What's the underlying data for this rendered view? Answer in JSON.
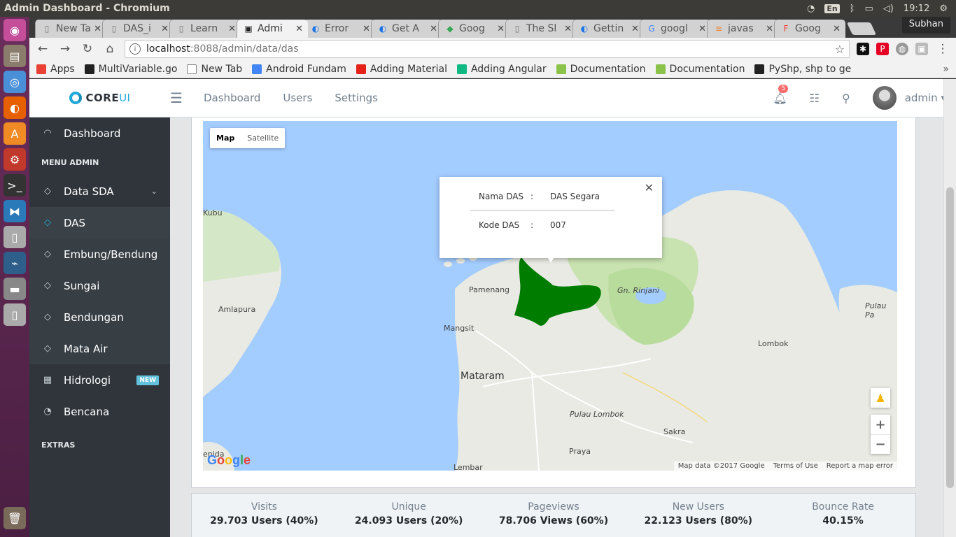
{
  "os": {
    "window_title": "Admin Dashboard - Chromium",
    "keyboard": "En",
    "clock": "19:12",
    "launcher_icons": [
      "ubuntu-dash-icon",
      "files-icon",
      "chromium-icon",
      "firefox-icon",
      "software-center-icon",
      "settings-icon",
      "terminal-icon",
      "vscode-icon",
      "usb-icon",
      "network-tool-icon",
      "drive-icon",
      "usb-icon-2",
      "trash-icon"
    ]
  },
  "browser": {
    "profile": "Subhan",
    "tabs": [
      {
        "label": "New Tab",
        "icon": "page-icon"
      },
      {
        "label": "DAS_i",
        "icon": "page-icon"
      },
      {
        "label": "Learn",
        "icon": "page-icon"
      },
      {
        "label": "Admi",
        "icon": "terminal-favicon",
        "active": true
      },
      {
        "label": "Error",
        "icon": "dev-favicon"
      },
      {
        "label": "Get A",
        "icon": "dev-favicon"
      },
      {
        "label": "Goog",
        "icon": "maps-favicon"
      },
      {
        "label": "The Sl",
        "icon": "page-icon"
      },
      {
        "label": "Gettin",
        "icon": "dev-favicon"
      },
      {
        "label": "googl",
        "icon": "google-favicon"
      },
      {
        "label": "javas",
        "icon": "stackoverflow-favicon"
      },
      {
        "label": "Goog",
        "icon": "firebase-favicon"
      }
    ],
    "url_host": "localhost",
    "url_path": ":8088/admin/data/das",
    "bookmarks": [
      {
        "label": "Apps",
        "color": "#e94235"
      },
      {
        "label": "MultiVariable.go",
        "color": "#222222"
      },
      {
        "label": "New Tab",
        "color": "#ffffff"
      },
      {
        "label": "Android Fundam",
        "color": "#4285f4"
      },
      {
        "label": "Adding Material",
        "color": "#e62117"
      },
      {
        "label": "Adding Angular",
        "color": "#10b981"
      },
      {
        "label": "Documentation",
        "color": "#8bc34a"
      },
      {
        "label": "Documentation",
        "color": "#8bc34a"
      },
      {
        "label": "PyShp, shp to ge",
        "color": "#222222"
      }
    ],
    "bookmarks_more": "»"
  },
  "header": {
    "brand_core": "CORE",
    "brand_ui": "UI",
    "nav": [
      "Dashboard",
      "Users",
      "Settings"
    ],
    "notification_count": "5",
    "user": "admin"
  },
  "sidebar": {
    "dashboard": "Dashboard",
    "menu_title": "MENU ADMIN",
    "items": [
      {
        "label": "Data SDA",
        "caret": true
      },
      {
        "label": "DAS",
        "active": true
      },
      {
        "label": "Embung/Bendung"
      },
      {
        "label": "Sungai"
      },
      {
        "label": "Bendungan"
      },
      {
        "label": "Mata Air"
      }
    ],
    "hidrologi": "Hidrologi",
    "hidrologi_badge": "NEW",
    "bencana": "Bencana",
    "extras_title": "EXTRAS"
  },
  "map": {
    "type_map": "Map",
    "type_satellite": "Satellite",
    "infowindow": {
      "rows": [
        {
          "key": "Nama DAS",
          "sep": ":",
          "value": "DAS Segara"
        },
        {
          "key": "Kode DAS",
          "sep": ":",
          "value": "007"
        }
      ]
    },
    "places": {
      "kubu": "Kubu",
      "amlapura": "Amlapura",
      "pamenang": "Pamenang",
      "mangsit": "Mangsit",
      "mataram": "Mataram",
      "rinjani": "Gn. Rinjani",
      "lombok": "Lombok",
      "pulau_p": "Pulau Pa",
      "pulau_lombok": "Pulau Lombok",
      "sakra": "Sakra",
      "praya": "Praya",
      "lembar": "Lembar",
      "penida": "enida"
    },
    "attribution": [
      "Map data ©2017 Google",
      "Terms of Use",
      "Report a map error"
    ],
    "logo": "Google",
    "polygon_color": "#007d00"
  },
  "stats": [
    {
      "label": "Visits",
      "value": "29.703 Users (40%)",
      "color": "#4dbd74",
      "progress": 0.4
    },
    {
      "label": "Unique",
      "value": "24.093 Users (20%)",
      "color": "#63c2de",
      "progress": 0.2
    },
    {
      "label": "Pageviews",
      "value": "78.706 Views (60%)",
      "color": "#ffc107",
      "progress": 0.6
    },
    {
      "label": "New Users",
      "value": "22.123 Users (80%)",
      "color": "#f86c6b",
      "progress": 0.8
    },
    {
      "label": "Bounce Rate",
      "value": "40.15%",
      "color": "#20a8d8",
      "progress": 0.4
    }
  ]
}
